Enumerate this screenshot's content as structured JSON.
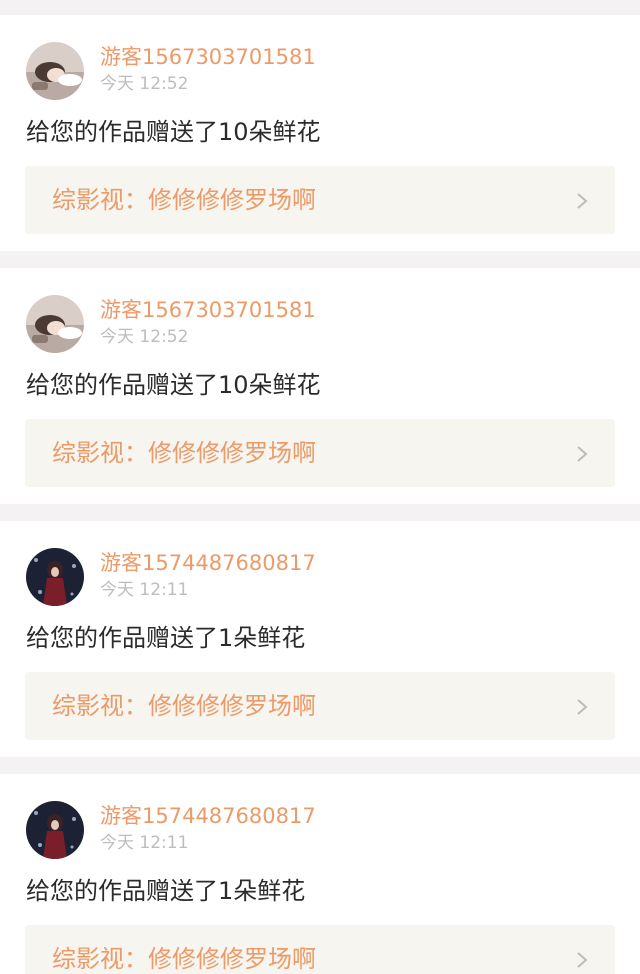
{
  "notifications": [
    {
      "username": "游客1567303701581",
      "time": "今天 12:52",
      "message": "给您的作品赠送了10朵鲜花",
      "work_title": "综影视：修修修修罗场啊",
      "avatar": "girl-lying-avatar"
    },
    {
      "username": "游客1567303701581",
      "time": "今天 12:52",
      "message": "给您的作品赠送了10朵鲜花",
      "work_title": "综影视：修修修修罗场啊",
      "avatar": "girl-lying-avatar"
    },
    {
      "username": "游客1574487680817",
      "time": "今天 12:11",
      "message": "给您的作品赠送了1朵鲜花",
      "work_title": "综影视：修修修修罗场啊",
      "avatar": "dark-figure-avatar"
    },
    {
      "username": "游客1574487680817",
      "time": "今天 12:11",
      "message": "给您的作品赠送了1朵鲜花",
      "work_title": "综影视：修修修修罗场啊",
      "avatar": "dark-figure-avatar"
    }
  ],
  "colors": {
    "accent": "#ec9a68",
    "page_background": "#f4f2f2",
    "card_background": "#ffffff",
    "link_background": "#f6f5ef",
    "muted_text": "#bdbdbd",
    "body_text": "#2b2b2b"
  },
  "icons": {
    "link_arrow": "chevron-right-icon"
  }
}
